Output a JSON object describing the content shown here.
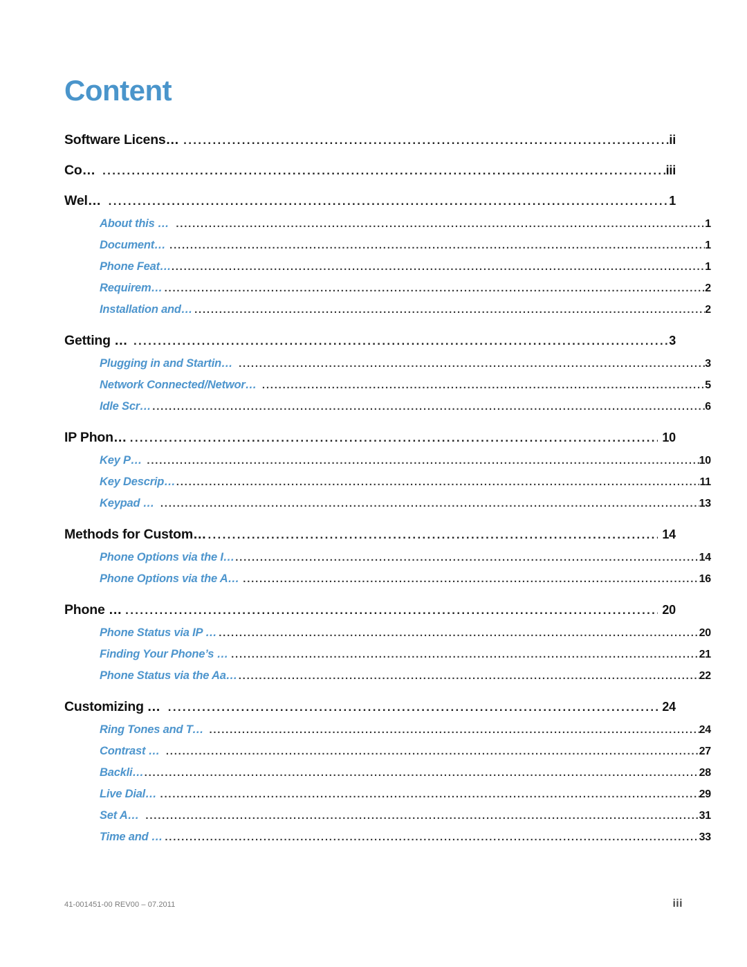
{
  "document": {
    "title": "Content",
    "title_color": "#4A95CB",
    "level2_color": "#4D95CD"
  },
  "toc": {
    "entries": [
      {
        "level": 1,
        "label": "Software License Agreement",
        "page": "ii"
      },
      {
        "level": 1,
        "label": "Content",
        "page": "iii"
      },
      {
        "level": 1,
        "label": "Welcome",
        "page": "1"
      },
      {
        "level": 2,
        "label": "About this Guide",
        "page": "1"
      },
      {
        "level": 2,
        "label": "Documentation",
        "page": "1"
      },
      {
        "level": 2,
        "label": "Phone Features",
        "page": "1"
      },
      {
        "level": 2,
        "label": "Requirements",
        "page": "2"
      },
      {
        "level": 2,
        "label": "Installation and Setup",
        "page": "2"
      },
      {
        "level": 1,
        "label": "Getting Started",
        "page": "3"
      },
      {
        "level": 2,
        "label": "Plugging in and Starting the Phone",
        "page": "3"
      },
      {
        "level": 2,
        "label": "Network Connected/Network Disconnected",
        "page": "5"
      },
      {
        "level": 2,
        "label": "Idle Screen",
        "page": "6"
      },
      {
        "level": 1,
        "label": "IP Phone Keys",
        "page": "10"
      },
      {
        "level": 2,
        "label": "Key Panel",
        "page": "10"
      },
      {
        "level": 2,
        "label": "Key Descriptions",
        "page": "11"
      },
      {
        "level": 2,
        "label": "Keypad Keys",
        "page": "13"
      },
      {
        "level": 1,
        "label": "Methods for Customizing Your Phone",
        "page": "14"
      },
      {
        "level": 2,
        "label": "Phone Options via the IP Phone UI",
        "page": "14"
      },
      {
        "level": 2,
        "label": "Phone Options via the Aastra Web UI",
        "page": "16"
      },
      {
        "level": 1,
        "label": "Phone Status",
        "page": "20"
      },
      {
        "level": 2,
        "label": "Phone Status via IP Phone UI",
        "page": "20"
      },
      {
        "level": 2,
        "label": "Finding Your Phone’s IP Address",
        "page": "21"
      },
      {
        "level": 2,
        "label": "Phone Status via the Aastra Web UI",
        "page": "22"
      },
      {
        "level": 1,
        "label": "Customizing Your Phone",
        "page": "24"
      },
      {
        "level": 2,
        "label": "Ring Tones and Tone Sets",
        "page": "24"
      },
      {
        "level": 2,
        "label": "Contrast Level",
        "page": "27"
      },
      {
        "level": 2,
        "label": "Backlight",
        "page": "28"
      },
      {
        "level": 2,
        "label": "Live Dialpad*",
        "page": "29"
      },
      {
        "level": 2,
        "label": "Set Audio",
        "page": "31"
      },
      {
        "level": 2,
        "label": "Time and Date",
        "page": "33"
      }
    ]
  },
  "footer": {
    "document_id": "41-001451-00 REV00 – 07.2011",
    "page_number": "iii"
  }
}
